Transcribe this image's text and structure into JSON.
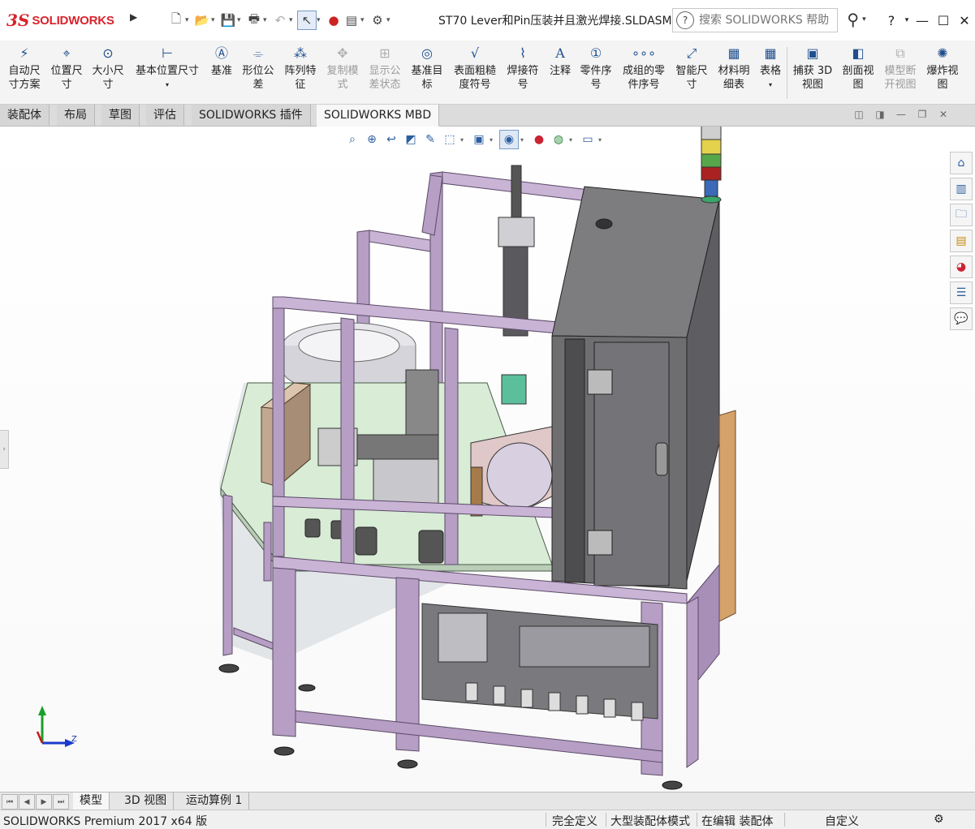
{
  "app": {
    "logo_ds": "3S",
    "logo_text": "SOLIDWORKS",
    "document_title": "ST70 Lever和Pin压装并且激光焊接.SLDASM *"
  },
  "search": {
    "placeholder": "搜索 SOLIDWORKS 帮助"
  },
  "window_controls": {
    "help": "?",
    "minimize": "—",
    "maximize": "☐",
    "close": "✕"
  },
  "ribbon": {
    "smart_dim": "自动尺\n寸方案",
    "location_dim": "位置尺\n寸",
    "size_dim": "大小尺\n寸",
    "basic_location_dim": "基本位置尺寸",
    "datum": "基准",
    "geometric_tolerance": "形位公\n差",
    "pattern_feature": "阵列特\n征",
    "copy_scheme": "复制模\n式",
    "show_tolerance_status": "显示公\n差状态",
    "datum_target": "基准目\n标",
    "surface_finish": "表面粗糙\n度符号",
    "weld_symbol": "焊接符\n号",
    "note": "注释",
    "balloon": "零件序\n号",
    "stacked_balloon": "成组的零\n件序号",
    "smart_dimension": "智能尺\n寸",
    "bom": "材料明\n细表",
    "table": "表格",
    "capture_3d_view": "捕获 3D\n视图",
    "section_view": "剖面视\n图",
    "model_break_view": "模型断\n开视图",
    "exploded_view": "爆炸视\n图"
  },
  "tabs": [
    "装配体",
    "布局",
    "草图",
    "评估",
    "SOLIDWORKS 插件",
    "SOLIDWORKS MBD"
  ],
  "bottom_tabs": [
    "模型",
    "3D 视图",
    "运动算例 1"
  ],
  "status": {
    "product": "SOLIDWORKS Premium 2017 x64 版",
    "definition": "完全定义",
    "mode": "大型装配体模式",
    "editing": "在编辑 装配体",
    "custom": "自定义"
  },
  "triad": {
    "z_label": "Z"
  },
  "colors": {
    "frame_purple": "#b69ec4",
    "table_green": "#d8ecd6",
    "cabinet_gray": "#6e6e70",
    "accent_blue": "#1f4f8f",
    "brand_red": "#d9232d"
  }
}
